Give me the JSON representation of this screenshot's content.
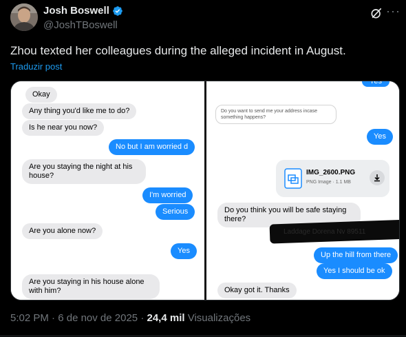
{
  "author": {
    "name": "Josh Boswell",
    "handle": "@JoshTBoswell"
  },
  "tweet": {
    "text": "Zhou texted her colleagues during the alleged incident in August.",
    "translate_label": "Traduzir post"
  },
  "left_panel": {
    "messages": [
      {
        "dir": "in",
        "text": "Okay"
      },
      {
        "dir": "in",
        "text": "Any thing you'd like me to do?"
      },
      {
        "dir": "in",
        "text": "Is he near you now?"
      },
      {
        "dir": "out",
        "text": "No but I am worried d"
      },
      {
        "dir": "in",
        "text": "Are you staying the night at his house?"
      },
      {
        "dir": "out",
        "text": "I'm worried"
      },
      {
        "dir": "out",
        "text": "Serious"
      },
      {
        "dir": "in",
        "text": "Are you alone now?"
      },
      {
        "dir": "out",
        "text": "Yes"
      },
      {
        "dir": "in",
        "text": "Are you staying in his house alone with him?"
      }
    ]
  },
  "right_panel": {
    "top_partial": "Yes",
    "system_msg": "Do you want to send me your address incase something happens?",
    "yes_msg": "Yes",
    "attachment": {
      "name": "IMG_2600.PNG",
      "meta": "PNG Image · 1.1 MB"
    },
    "messages": [
      {
        "dir": "in",
        "text": "Do you think you will be safe staying there?"
      },
      {
        "dir": "out",
        "text": "Up the hill from there"
      },
      {
        "dir": "out",
        "text": "Yes I should be ok"
      },
      {
        "dir": "in",
        "text": "Okay got it. Thanks"
      }
    ],
    "redacted_text": "Laddage Dorena Nv 89511"
  },
  "footer": {
    "time": "5:02 PM",
    "date": "6 de nov de 2025",
    "views": "24,4 mil",
    "views_label": "Visualizações"
  },
  "colors": {
    "accent": "#1d9bf0",
    "bubble_out": "#1a8cff",
    "bubble_in": "#e9e9eb"
  },
  "icons": [
    "verified-badge-icon",
    "grok-icon",
    "more-icon",
    "file-image-icon",
    "download-icon"
  ]
}
